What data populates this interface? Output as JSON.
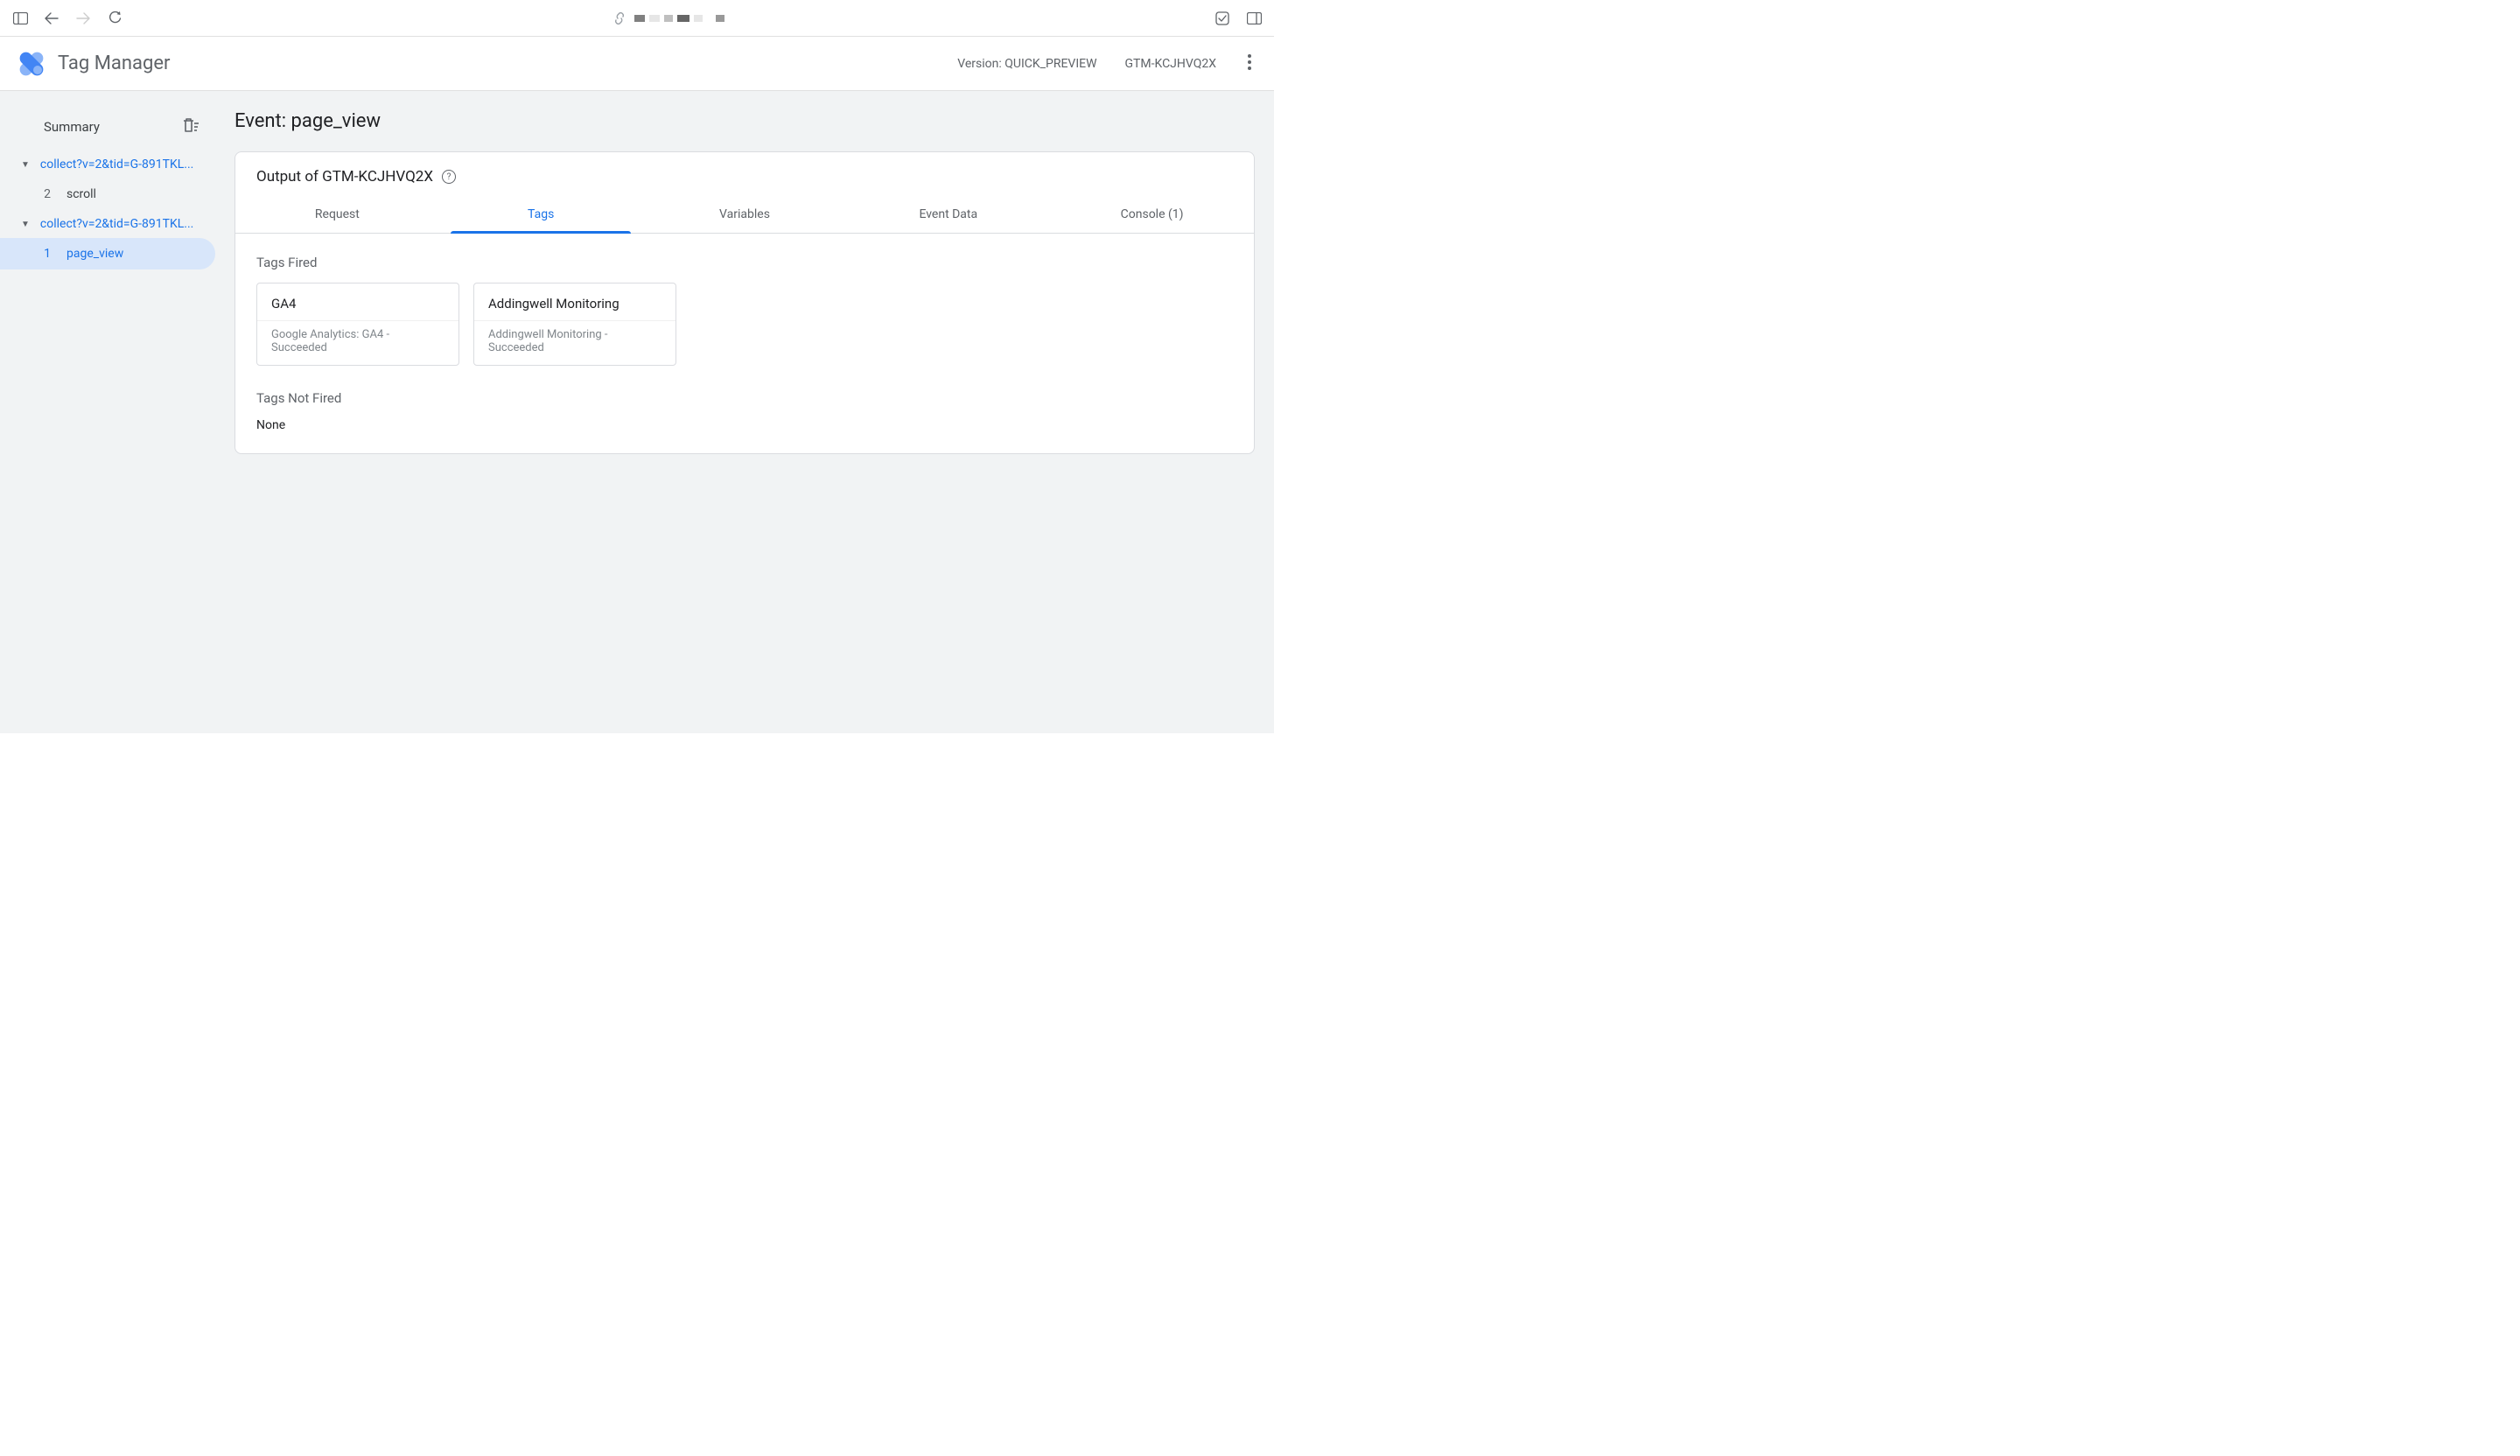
{
  "header": {
    "app_title": "Tag Manager",
    "version": "Version: QUICK_PREVIEW",
    "container_id": "GTM-KCJHVQ2X"
  },
  "sidebar": {
    "summary_label": "Summary",
    "groups": [
      {
        "label": "collect?v=2&tid=G-891TKL...",
        "children": [
          {
            "num": "2",
            "label": "scroll",
            "selected": false
          }
        ]
      },
      {
        "label": "collect?v=2&tid=G-891TKL...",
        "children": [
          {
            "num": "1",
            "label": "page_view",
            "selected": true
          }
        ]
      }
    ]
  },
  "content": {
    "event_title": "Event: page_view",
    "panel_title": "Output of GTM-KCJHVQ2X",
    "tabs": [
      {
        "label": "Request",
        "active": false
      },
      {
        "label": "Tags",
        "active": true
      },
      {
        "label": "Variables",
        "active": false
      },
      {
        "label": "Event Data",
        "active": false
      },
      {
        "label": "Console (1)",
        "active": false
      }
    ],
    "tags_fired_label": "Tags Fired",
    "tags_fired": [
      {
        "title": "GA4",
        "subtitle": "Google Analytics: GA4 - Succeeded"
      },
      {
        "title": "Addingwell Monitoring",
        "subtitle": "Addingwell Monitoring - Succeeded"
      }
    ],
    "tags_not_fired_label": "Tags Not Fired",
    "tags_not_fired_text": "None"
  }
}
